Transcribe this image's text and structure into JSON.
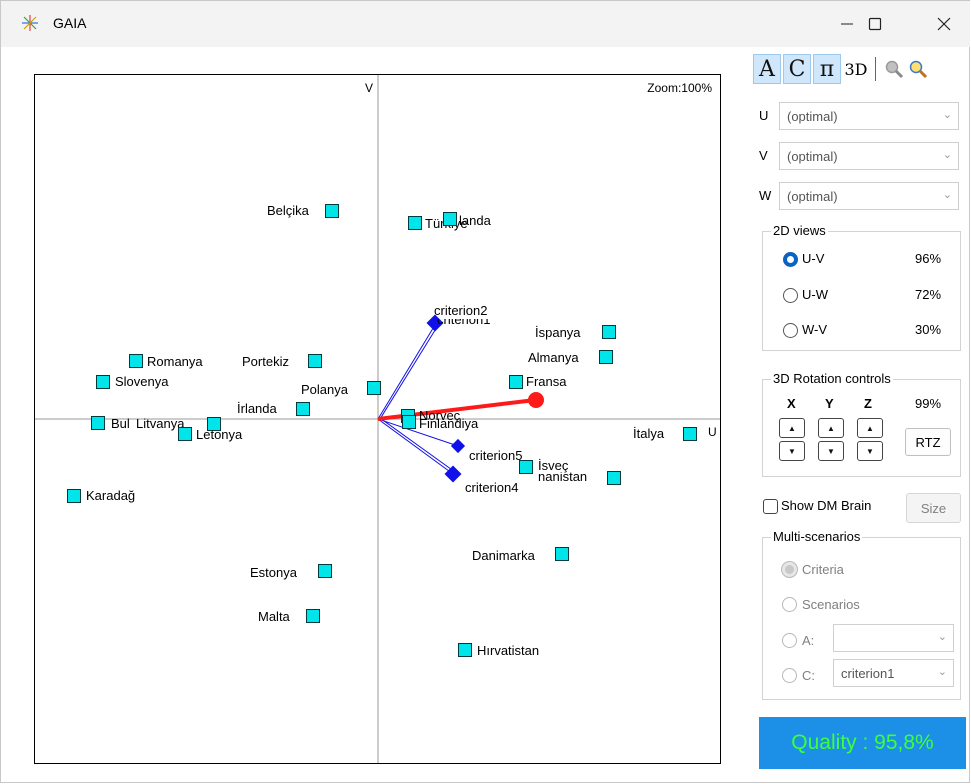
{
  "window": {
    "title": "GAIA",
    "minimize_icon": "minimize-icon",
    "maximize_icon": "maximize-icon",
    "close_icon": "close-icon"
  },
  "plot": {
    "zoom_label": "Zoom:100%",
    "u_axis_label": "U",
    "v_axis_label": "V",
    "alternatives": [
      "Belçika",
      "Türkiye",
      "landa",
      "İspanya",
      "Almanya",
      "Fransa",
      "Romanya",
      "Portekiz",
      "Slovenya",
      "Polanya",
      "İrlanda",
      "Bul",
      "Litvanya",
      "Letonya",
      "Norveç",
      "Finlandiya",
      "İtalya",
      "criterion5",
      "İsveç",
      "nanistan",
      "Karadağ",
      "Danimarka",
      "Estonya",
      "Malta",
      "Hırvatistan"
    ],
    "criteria": [
      "criterion2",
      "criterion1",
      "criterion5",
      "criterion4"
    ],
    "colors": {
      "marker": "#00e5ea",
      "criterion": "#1010e8",
      "decision_axis": "#ff1a1a",
      "axis": "#999999"
    }
  },
  "toolbar": {
    "alternatives_button": "A",
    "criteria_button": "C",
    "pi_button": "π",
    "view3d_button": "3D",
    "zoom_out_icon": "zoom-out-icon",
    "zoom_in_icon": "zoom-in-icon"
  },
  "axes": [
    {
      "label": "U",
      "value": "(optimal)"
    },
    {
      "label": "V",
      "value": "(optimal)"
    },
    {
      "label": "W",
      "value": "(optimal)"
    }
  ],
  "views_2d": {
    "title": "2D views",
    "options": [
      {
        "label": "U-V",
        "percent": "96%",
        "selected": true
      },
      {
        "label": "U-W",
        "percent": "72%",
        "selected": false
      },
      {
        "label": "W-V",
        "percent": "30%",
        "selected": false
      }
    ]
  },
  "rotation": {
    "title": "3D Rotation controls",
    "x": "X",
    "y": "Y",
    "z": "Z",
    "percent": "99%",
    "rtz_button": "RTZ",
    "up_icon": "arrow-up-icon",
    "down_icon": "arrow-down-icon"
  },
  "dm_brain": {
    "label": "Show DM Brain",
    "checked": false,
    "size_button": "Size"
  },
  "multi_scenarios": {
    "title": "Multi-scenarios",
    "criteria_option": "Criteria",
    "scenarios_option": "Scenarios",
    "a_label": "A:",
    "a_value": "",
    "c_label": "C:",
    "c_value": "criterion1"
  },
  "quality": {
    "label": "Quality : 95,8%",
    "bg": "#1c8fe6",
    "text_color": "#3cff3c"
  }
}
